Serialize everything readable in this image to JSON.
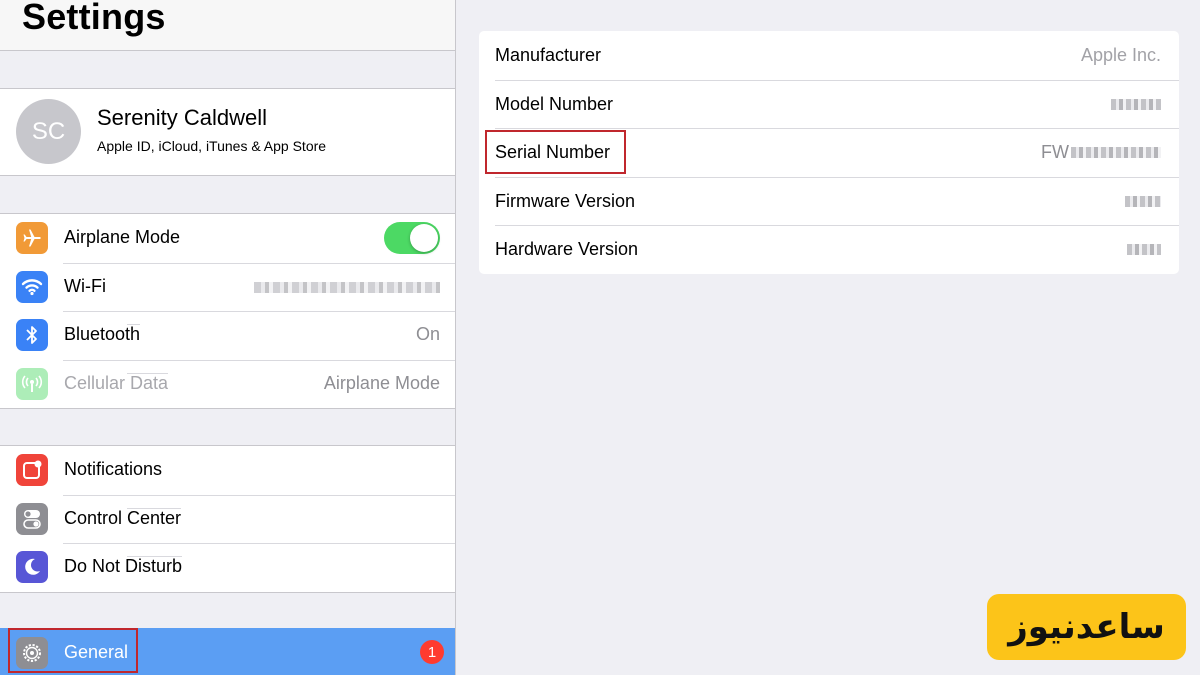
{
  "sidebar": {
    "title": "Settings",
    "profile": {
      "initials": "SC",
      "name": "Serenity Caldwell",
      "subtitle": "Apple ID, iCloud, iTunes & App Store"
    },
    "group1": [
      {
        "label": "Airplane Mode",
        "icon": "airplane-icon",
        "color": "#f19a37",
        "toggle": true
      },
      {
        "label": "Wi-Fi",
        "icon": "wifi-icon",
        "color": "#3a82f6",
        "value_redacted": true
      },
      {
        "label": "Bluetooth",
        "icon": "bluetooth-icon",
        "color": "#3a82f6",
        "value": "On"
      },
      {
        "label": "Cellular Data",
        "icon": "cellular-icon",
        "color": "#4cd964",
        "value": "Airplane Mode",
        "disabled": true
      }
    ],
    "group2": [
      {
        "label": "Notifications",
        "icon": "notifications-icon",
        "color": "#f0443a"
      },
      {
        "label": "Control Center",
        "icon": "control-center-icon",
        "color": "#8e8e93"
      },
      {
        "label": "Do Not Disturb",
        "icon": "moon-icon",
        "color": "#5856d6"
      }
    ],
    "general": {
      "label": "General",
      "icon": "gear-icon",
      "badge": "1",
      "selected_color": "#5b9ef3"
    }
  },
  "about": {
    "rows": [
      {
        "label": "Manufacturer",
        "value": "Apple Inc."
      },
      {
        "label": "Model Number",
        "value": ""
      },
      {
        "label": "Serial Number",
        "value": "FW"
      },
      {
        "label": "Firmware Version",
        "value": ""
      },
      {
        "label": "Hardware Version",
        "value": ""
      }
    ]
  },
  "watermark": {
    "text": "ساعدنیوز",
    "color": "#fcc419"
  },
  "colors": {
    "highlight_box": "#c0272d",
    "toggle_on": "#4cd964"
  }
}
